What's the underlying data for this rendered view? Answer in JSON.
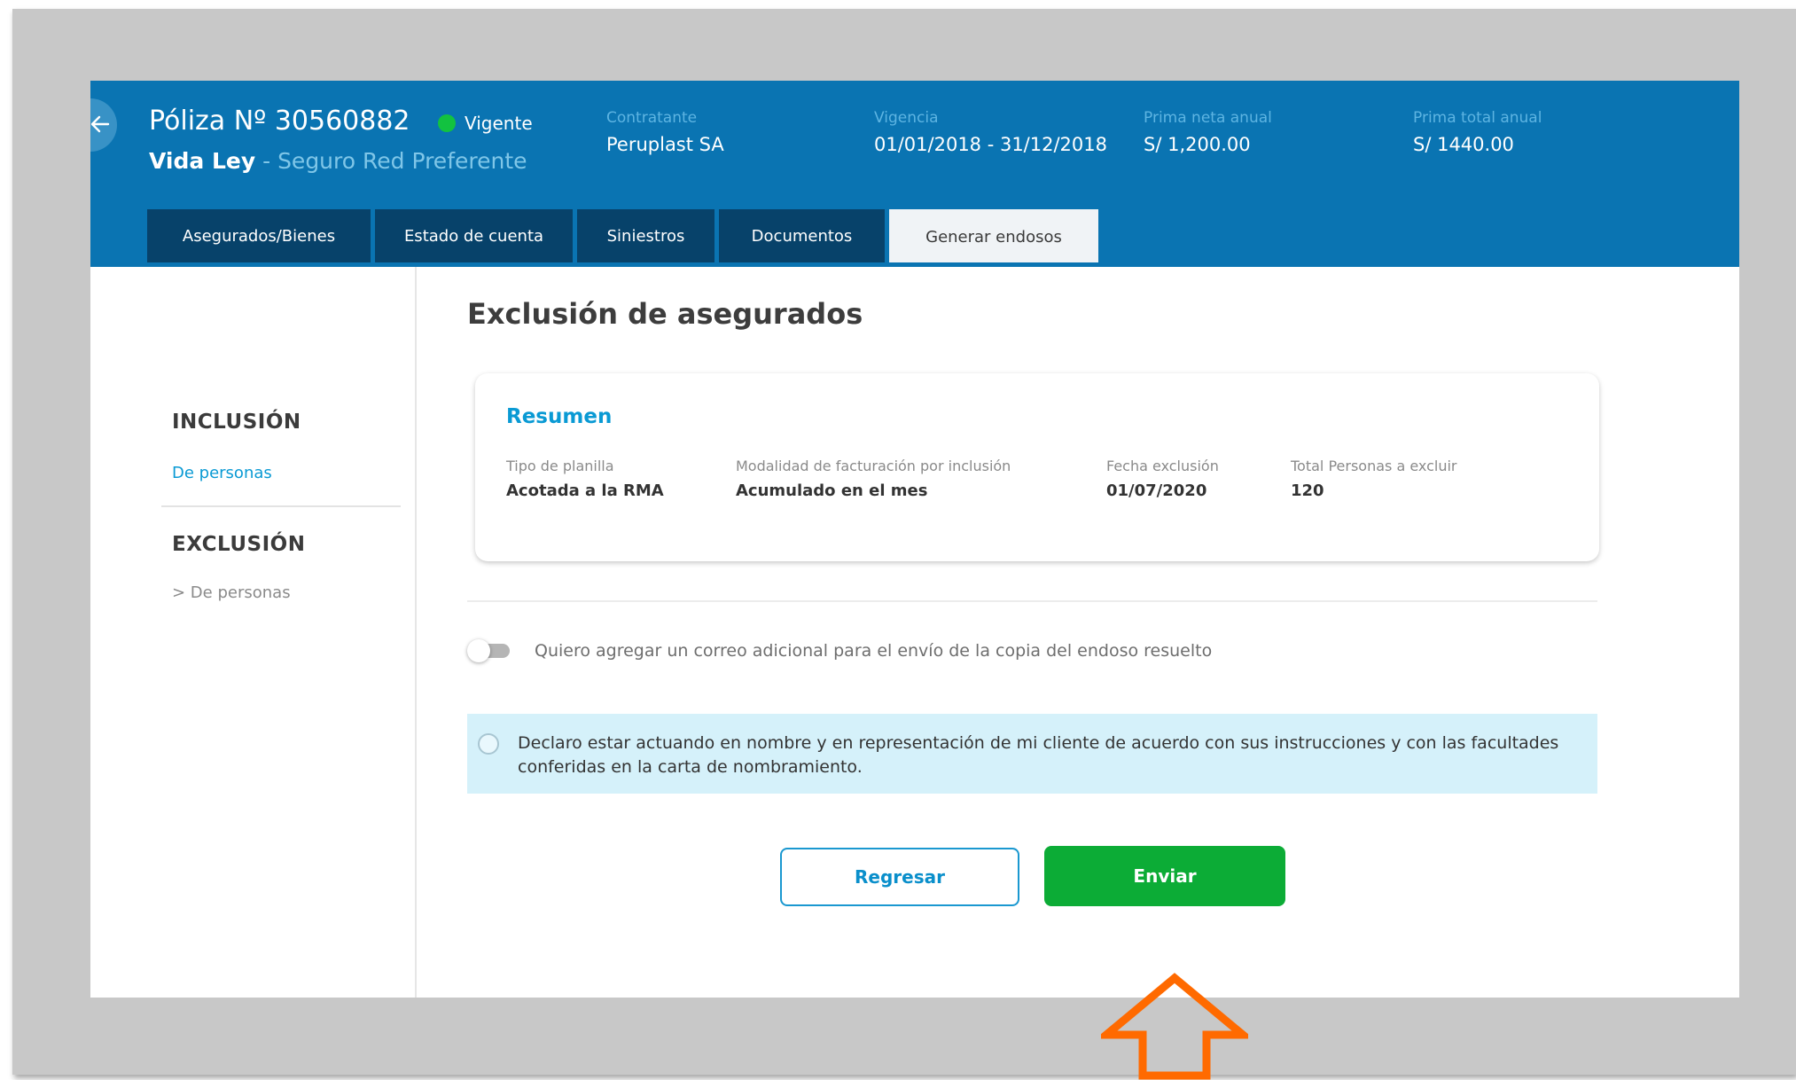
{
  "header": {
    "policy_title": "Póliza Nº 30560882",
    "status": "Vigente",
    "product": "Vida Ley",
    "separator": " - ",
    "plan": "Seguro Red Preferente",
    "fields": [
      {
        "label": "Contratante",
        "value": "Peruplast SA"
      },
      {
        "label": "Vigencia",
        "value": "01/01/2018 - 31/12/2018"
      },
      {
        "label": "Prima neta anual",
        "value": "S/ 1,200.00"
      },
      {
        "label": "Prima total anual",
        "value": "S/ 1440.00"
      }
    ],
    "colors": {
      "background": "#0a74b2",
      "status_dot": "#12c240"
    }
  },
  "tabs": [
    {
      "label": "Asegurados/Bienes",
      "active": false
    },
    {
      "label": "Estado de cuenta",
      "active": false
    },
    {
      "label": "Siniestros",
      "active": false
    },
    {
      "label": "Documentos",
      "active": false
    },
    {
      "label": "Generar endosos",
      "active": true
    }
  ],
  "sidebar": {
    "inclusion_heading": "INCLUSIÓN",
    "inclusion_link": "De personas",
    "exclusion_heading": "EXCLUSIÓN",
    "exclusion_link": "> De personas"
  },
  "main": {
    "title": "Exclusión de asegurados",
    "summary": {
      "title": "Resumen",
      "fields": [
        {
          "label": "Tipo de planilla",
          "value": "Acotada a la RMA"
        },
        {
          "label": "Modalidad de facturación por inclusión",
          "value": "Acumulado en el mes"
        },
        {
          "label": "Fecha exclusión",
          "value": "01/07/2020"
        },
        {
          "label": "Total Personas a excluir",
          "value": "120"
        }
      ]
    },
    "toggle_label": "Quiero agregar un correo adicional para el envío de la copia del endoso resuelto",
    "toggle_on": false,
    "declaration": "Declaro estar actuando en nombre y en representación de mi cliente de acuerdo con sus instrucciones y con las facultades conferidas en la carta de nombramiento.",
    "declaration_checked": false,
    "buttons": {
      "back": "Regresar",
      "send": "Enviar"
    },
    "colors": {
      "send_button": "#0cac36",
      "accent": "#0a9ad4",
      "annotation_arrow": "#ff6a00"
    }
  }
}
